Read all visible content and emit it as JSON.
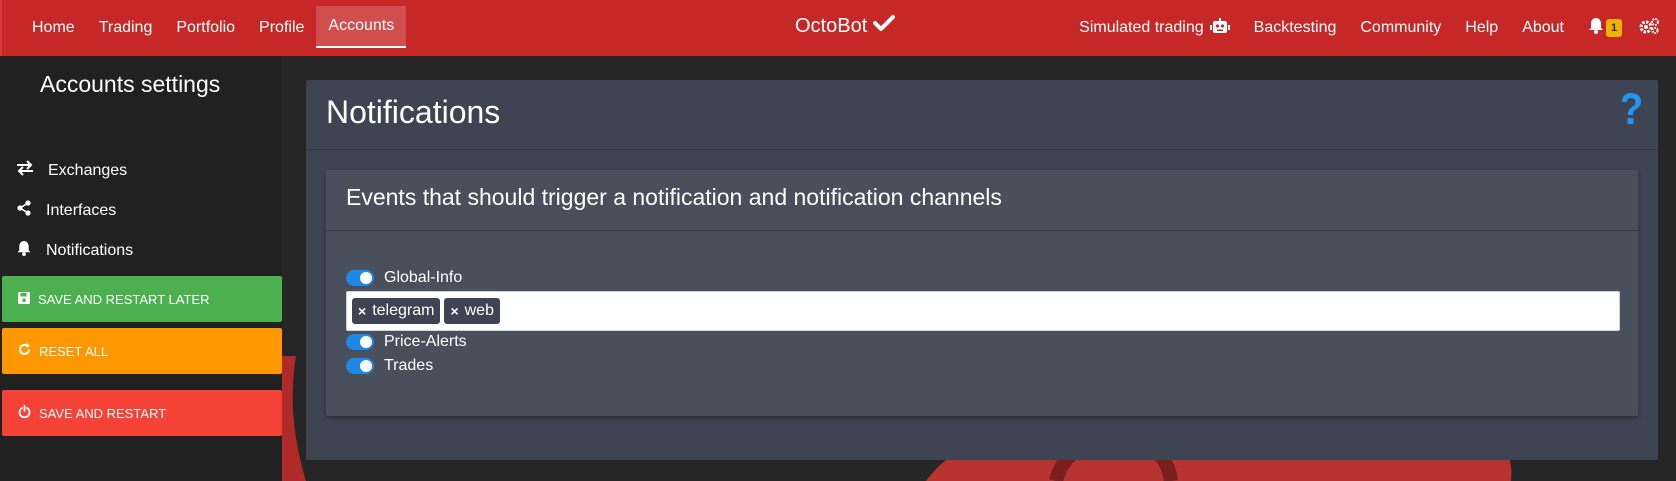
{
  "nav": {
    "left_items": [
      {
        "label": "Home"
      },
      {
        "label": "Trading"
      },
      {
        "label": "Portfolio"
      },
      {
        "label": "Profile"
      },
      {
        "label": "Accounts"
      }
    ],
    "brand": "OctoBot",
    "right_items": [
      {
        "label": "Simulated trading"
      },
      {
        "label": "Backtesting"
      },
      {
        "label": "Community"
      },
      {
        "label": "Help"
      },
      {
        "label": "About"
      }
    ],
    "notification_count": "1",
    "colors": {
      "navbar": "#c62828",
      "badge": "#f0b400"
    }
  },
  "sidebar": {
    "title": "Accounts settings",
    "links": [
      {
        "label": "Exchanges",
        "icon": "exchange-icon"
      },
      {
        "label": "Interfaces",
        "icon": "share-icon"
      },
      {
        "label": "Notifications",
        "icon": "bell-icon"
      }
    ],
    "buttons": {
      "save_later": "SAVE AND RESTART LATER",
      "reset": "RESET ALL",
      "save_restart": "SAVE AND RESTART"
    },
    "colors": {
      "save_later": "#4caf50",
      "reset": "#ff9800",
      "save_restart": "#f44336"
    }
  },
  "main": {
    "title": "Notifications",
    "help_icon": "question-icon",
    "section_title": "Events that should trigger a notification and notification channels",
    "events": [
      {
        "label": "Global-Info",
        "enabled": true
      },
      {
        "label": "Price-Alerts",
        "enabled": true
      },
      {
        "label": "Trades",
        "enabled": true
      }
    ],
    "channels": [
      {
        "label": "telegram"
      },
      {
        "label": "web"
      }
    ],
    "tag_remove": "×"
  }
}
